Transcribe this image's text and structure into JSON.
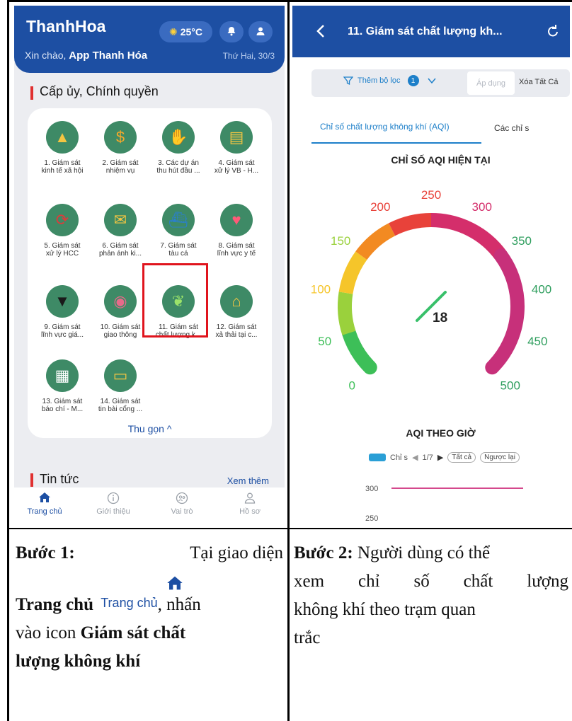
{
  "left_phone": {
    "brand": "ThanhHoa",
    "weather": "25°C",
    "greeting_prefix": "Xin chào, ",
    "greeting_app": "App Thanh Hóa",
    "date": "Thứ Hai, 30/3",
    "section_title": "Cấp ủy, Chính quyền",
    "tiles": [
      {
        "label": "1. Giám sát\nkinh tế xã hội",
        "icon": "chart-growth-icon",
        "color": "#3e8a66"
      },
      {
        "label": "2. Giám sát\nnhiệm vụ",
        "icon": "coin-icon",
        "color": "#3e8a66"
      },
      {
        "label": "3. Các dự án\nthu hút đầu ...",
        "icon": "hand-coin-icon",
        "color": "#3e8a66"
      },
      {
        "label": "4. Giám sát\nxử lý VB - H...",
        "icon": "document-stack-icon",
        "color": "#3e8a66"
      },
      {
        "label": "5. Giám sát\nxử lý HCC",
        "icon": "cycle-arrows-icon",
        "color": "#3e8a66"
      },
      {
        "label": "6. Giám sát\nphản ánh ki...",
        "icon": "envelope-icon",
        "color": "#3e8a66"
      },
      {
        "label": "7. Giám sát\ntàu cá",
        "icon": "ship-icon",
        "color": "#3e8a66"
      },
      {
        "label": "8. Giám sát\nlĩnh vực y tế",
        "icon": "heartbeat-icon",
        "color": "#3e8a66"
      },
      {
        "label": "9. Giám sát\nlĩnh vực giá...",
        "icon": "graduation-cap-icon",
        "color": "#3e8a66"
      },
      {
        "label": "10. Giám sát\ngiao thông",
        "icon": "camera-icon",
        "color": "#3e8a66"
      },
      {
        "label": "11. Giám sát\nchất lượng k...",
        "icon": "earth-leaf-icon",
        "color": "#3e8a66"
      },
      {
        "label": "12. Giám sát\nxả thải tại c...",
        "icon": "factory-icon",
        "color": "#3e8a66"
      },
      {
        "label": "13. Giám sát\nbáo chí - M...",
        "icon": "newspaper-icon",
        "color": "#3e8a66"
      },
      {
        "label": "14. Giám sát\ntin bài cổng ...",
        "icon": "monitor-icon",
        "color": "#3e8a66"
      }
    ],
    "collapse_label": "Thu gọn ^",
    "news_title": "Tin tức",
    "see_more": "Xem thêm",
    "nav": [
      {
        "label": "Trang chủ",
        "icon": "home-icon",
        "active": true
      },
      {
        "label": "Giới thiệu",
        "icon": "info-icon",
        "active": false
      },
      {
        "label": "Vai trò",
        "icon": "role-icon",
        "active": false
      },
      {
        "label": "Hồ sơ",
        "icon": "profile-icon",
        "active": false
      }
    ]
  },
  "right_phone": {
    "title": "11. Giám sát chất lượng kh...",
    "filter_add": "Thêm bộ lọc",
    "filter_count": "1",
    "filter_apply": "Áp dụng",
    "filter_clear": "Xóa Tất Cả",
    "tab_active": "Chỉ số chất lượng không khí (AQI)",
    "tab_other": "Các chỉ s",
    "gauge_title": "CHỈ SỐ AQI HIỆN TẠI",
    "gauge_value": "18",
    "gauge_ticks": [
      "0",
      "50",
      "100",
      "150",
      "200",
      "250",
      "300",
      "350",
      "400",
      "450",
      "500"
    ],
    "hour_title": "AQI THEO GIỜ",
    "legend_series": "Chỉ s",
    "pager": "1/7",
    "btn_all": "Tất cả",
    "btn_reverse": "Ngược lại",
    "y_ticks": [
      "300",
      "250"
    ]
  },
  "chart_data": {
    "type": "gauge",
    "title": "CHỈ SỐ AQI HIỆN TẠI",
    "value": 18,
    "range": [
      0,
      500
    ],
    "ticks": [
      0,
      50,
      100,
      150,
      200,
      250,
      300,
      350,
      400,
      450,
      500
    ],
    "colors": [
      "#3dbf58",
      "#9ad13c",
      "#f5c52a",
      "#f28a22",
      "#e8423a",
      "#d42e6b",
      "#c7307a"
    ]
  },
  "captions": {
    "step1_label": "Bước 1:",
    "step1_text_a": "Tại giao diện",
    "step1_home_bold": "Trang chủ",
    "step1_home_img": "Trang chủ",
    "step1_text_b": ", nhấn",
    "step1_text_c": "vào icon",
    "step1_bold2": "Giám sát chất",
    "step1_bold3": "lượng không khí",
    "step2_label": "Bước 2:",
    "step2_l1": "Người dùng có thể",
    "step2_l2": "xem chỉ số chất lượng",
    "step2_l3": "không khí theo trạm quan",
    "step2_l4": "trắc"
  }
}
